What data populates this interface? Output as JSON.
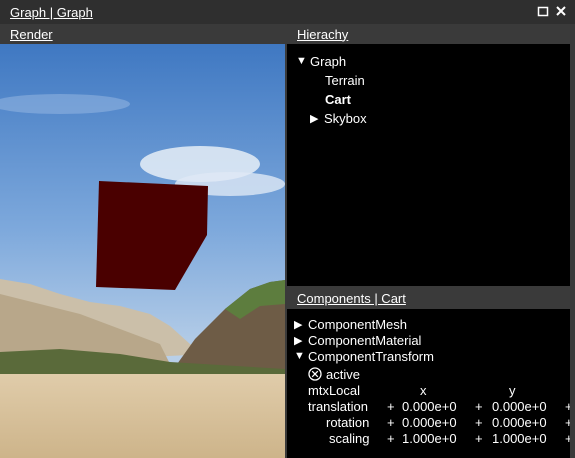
{
  "window": {
    "title": "Graph | Graph",
    "icons": [
      "maximize-icon",
      "close-icon"
    ]
  },
  "render": {
    "header": "Render",
    "scene_colors": {
      "sky_top": "#4f84c9",
      "sky_bottom": "#a9c6e6",
      "cube": "#4a0000",
      "sand": "#d9c39c",
      "hill": "#6b5b47"
    }
  },
  "hierarchy": {
    "header": "Hierachy",
    "items": [
      {
        "label": "Graph",
        "expander": "▼"
      },
      {
        "label": "Terrain",
        "expander": ""
      },
      {
        "label": "Cart",
        "expander": ""
      },
      {
        "label": "Skybox",
        "expander": "▶"
      }
    ]
  },
  "components": {
    "header": "Components | Cart",
    "items": [
      {
        "label": "ComponentMesh",
        "expander": "▶"
      },
      {
        "label": "ComponentMaterial",
        "expander": "▶"
      },
      {
        "label": "ComponentTransform",
        "expander": "▼"
      }
    ],
    "active_label": "active",
    "matrix_label": "mtxLocal",
    "columns": [
      "x",
      "y"
    ],
    "rows": [
      {
        "label": "translation",
        "values": [
          "0.000e+0",
          "0.000e+0"
        ]
      },
      {
        "label": "rotation",
        "values": [
          "0.000e+0",
          "0.000e+0"
        ]
      },
      {
        "label": "scaling",
        "values": [
          "1.000e+0",
          "1.000e+0"
        ]
      }
    ],
    "plus_sign": "+"
  }
}
